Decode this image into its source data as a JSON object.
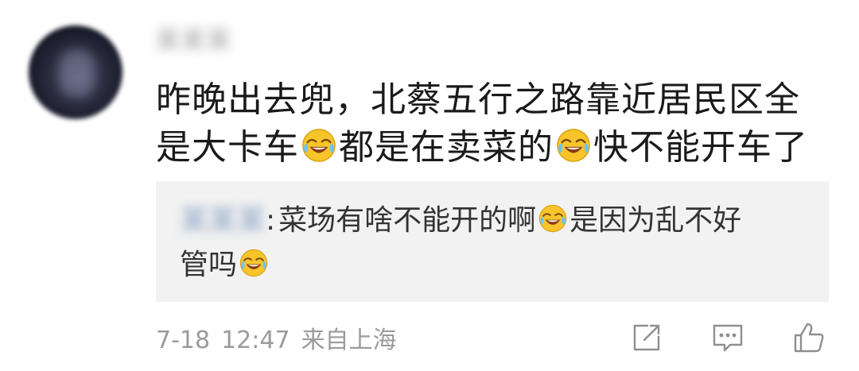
{
  "comment": {
    "username": "某某某",
    "text_line1": "昨晚出去兜，北蔡五行之路靠近居民区全",
    "text_line2_a": "是大卡车",
    "text_line2_b": "都是在卖菜的",
    "text_line2_c": "快不能开车了",
    "emoji": "laugh-cry-emoji"
  },
  "reply": {
    "username": "某某某",
    "colon": ":",
    "line1_a": "菜场有啥不能开的啊",
    "line1_b": "是因为乱不好",
    "line2": "管吗"
  },
  "meta": {
    "date": "7-18",
    "time": "12:47",
    "source": "来自上海"
  },
  "actions": {
    "icons": [
      "share-icon",
      "comment-icon",
      "like-icon"
    ]
  },
  "colors": {
    "reply_background": "#f2f2f2",
    "meta_text": "#9b9b9b",
    "text": "#1a1a1a",
    "emoji_face": "#f7c52a"
  }
}
